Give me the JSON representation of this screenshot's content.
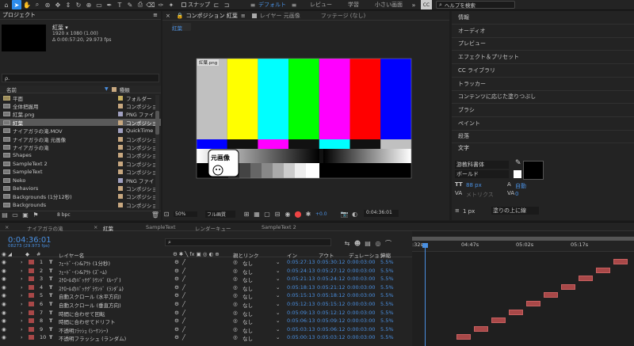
{
  "toolbar": {
    "snap_label": "スナップ",
    "workspaces": [
      "デフォルト",
      "レビュー",
      "学習",
      "小さい画面"
    ],
    "search_placeholder": "ヘルプを検索"
  },
  "project": {
    "title": "プロジェクト",
    "item_name": "紅葉 ▾",
    "item_size": "1920 x 1080 (1.00)",
    "item_duration": "Δ 0:00:57:20, 29.973 fps",
    "search_placeholder": "ρ.",
    "col_name": "名前",
    "col_type": "種類",
    "rows": [
      {
        "name": "平面",
        "type": "フォルダー",
        "icon": "folder",
        "color": "#c8b060"
      },
      {
        "name": "全体把握用",
        "type": "コンポジション",
        "icon": "comp",
        "color": "#c8a880"
      },
      {
        "name": "紅葉.png",
        "type": "PNG ファイ",
        "icon": "image",
        "color": "#a0a0c0"
      },
      {
        "name": "紅葉",
        "type": "コンポジション",
        "icon": "comp",
        "color": "#c8a880",
        "selected": true
      },
      {
        "name": "ナイアガラの滝.MOV",
        "type": "QuickTime",
        "icon": "movie",
        "color": "#a0a0c0"
      },
      {
        "name": "ナイアガラの滝 元画像",
        "type": "コンポジション",
        "icon": "comp",
        "color": "#c8a880"
      },
      {
        "name": "ナイアガラの滝",
        "type": "コンポジション",
        "icon": "comp",
        "color": "#c8a880"
      },
      {
        "name": "Shapes",
        "type": "コンポジション",
        "icon": "comp",
        "color": "#c8a880"
      },
      {
        "name": "SampleText 2",
        "type": "コンポジション",
        "icon": "comp",
        "color": "#c8a880"
      },
      {
        "name": "SampleText",
        "type": "コンポジション",
        "icon": "comp",
        "color": "#c8a880"
      },
      {
        "name": "Neko",
        "type": "PNG ファイ",
        "icon": "image",
        "color": "#a0a0c0"
      },
      {
        "name": "Behaviors",
        "type": "コンポジション",
        "icon": "comp",
        "color": "#c8a880"
      },
      {
        "name": "Backgrounds (1分12秒)",
        "type": "コンポジション",
        "icon": "comp",
        "color": "#c8a880"
      },
      {
        "name": "Backgrounds",
        "type": "コンポジション",
        "icon": "comp",
        "color": "#c8a880"
      }
    ],
    "bpc": "8 bpc"
  },
  "comp": {
    "tab_active": "コンポジション 紅葉",
    "tab_layer": "レイヤー 元画像",
    "tab_footage": "フッテージ (なし)",
    "subtab": "紅葉",
    "layer_label": "紅葉.png",
    "sticker_text": "元画像",
    "zoom": "50%",
    "quality": "フル画質",
    "exposure": "+0.0",
    "timecode": "0:04:36:01"
  },
  "right_panel": {
    "items": [
      "情報",
      "オーディオ",
      "プレビュー",
      "エフェクト＆プリセット",
      "CC ライブラリ",
      "トラッカー",
      "コンテンツに応じた塗りつぶし",
      "ブラシ",
      "ペイント",
      "段落"
    ],
    "char_title": "文字",
    "font_family": "游教科書体",
    "font_style": "ボールド",
    "font_size": "88 px",
    "leading": "自動",
    "kerning": "メトリクス",
    "tracking": "0",
    "stroke_width": "1 px",
    "stroke_mode": "塗りの上に線"
  },
  "timeline": {
    "tabs": [
      "ナイアガラの滝",
      "紅葉",
      "SampleText",
      "レンダーキュー",
      "SampleText 2"
    ],
    "current_time": "0:04:36:01",
    "fps_info": "08273 (29.973 fps)",
    "col_layer_name": "レイヤー名",
    "col_parent": "親とリンク",
    "col_in": "イン",
    "col_out": "アウト",
    "col_duration": "デュレーション",
    "col_stretch": "伸縮",
    "ruler": [
      ":32s",
      "04:47s",
      "05:02s",
      "05:17s"
    ],
    "layers": [
      {
        "num": "1",
        "name": "ﾌｪｰﾄﾞ･ｲﾝ&ｱｳﾄ (1分秒)",
        "parent": "なし",
        "in": "0:05:27:13",
        "out": "0:05:30:12",
        "dur": "0:00:03:00",
        "stretch": "5.5%"
      },
      {
        "num": "2",
        "name": "ﾌｪｰﾄﾞ･ｲﾝ&ｱｳﾄ (ｽﾞｰﾑ)",
        "parent": "なし",
        "in": "0:05:24:13",
        "out": "0:05:27:12",
        "dur": "0:00:03:00",
        "stretch": "5.5%"
      },
      {
        "num": "3",
        "name": "ｽｸﾛｰﾙのﾊﾞｯｸｸﾞﾗｳﾝﾄﾞ (ﾙｰﾌﾟ)",
        "parent": "なし",
        "in": "0:05:21:13",
        "out": "0:05:24:12",
        "dur": "0:00:03:00",
        "stretch": "5.5%"
      },
      {
        "num": "4",
        "name": "ｽｸﾛｰﾙのﾊﾞｯｸｸﾞﾗｳﾝﾄﾞ (ﾗﾝﾀﾞﾑ)",
        "parent": "なし",
        "in": "0:05:18:13",
        "out": "0:05:21:12",
        "dur": "0:00:03:00",
        "stretch": "5.5%"
      },
      {
        "num": "5",
        "name": "自動スクロール (水平方向)",
        "parent": "なし",
        "in": "0:05:15:13",
        "out": "0:05:18:12",
        "dur": "0:00:03:00",
        "stretch": "5.5%"
      },
      {
        "num": "6",
        "name": "自動スクロール (垂直方向)",
        "parent": "なし",
        "in": "0:05:12:13",
        "out": "0:05:15:12",
        "dur": "0:00:03:00",
        "stretch": "5.5%"
      },
      {
        "num": "7",
        "name": "時間に合わせて回転",
        "parent": "なし",
        "in": "0:05:09:13",
        "out": "0:05:12:12",
        "dur": "0:00:03:00",
        "stretch": "5.5%"
      },
      {
        "num": "8",
        "name": "時間に合わせてドリフト",
        "parent": "なし",
        "in": "0:05:06:13",
        "out": "0:05:09:12",
        "dur": "0:00:03:00",
        "stretch": "5.5%"
      },
      {
        "num": "9",
        "name": "不透明ﾌﾗｯｼｭ (ｼｰｹﾝｼｰ)",
        "parent": "なし",
        "in": "0:05:03:13",
        "out": "0:05:06:12",
        "dur": "0:00:03:00",
        "stretch": "5.5%"
      },
      {
        "num": "10",
        "name": "不透明フラッシュ (ランダム)",
        "parent": "なし",
        "in": "0:05:00:13",
        "out": "0:05:03:12",
        "dur": "0:00:03:00",
        "stretch": "5.5%"
      }
    ],
    "bar_color": "#a84848"
  }
}
